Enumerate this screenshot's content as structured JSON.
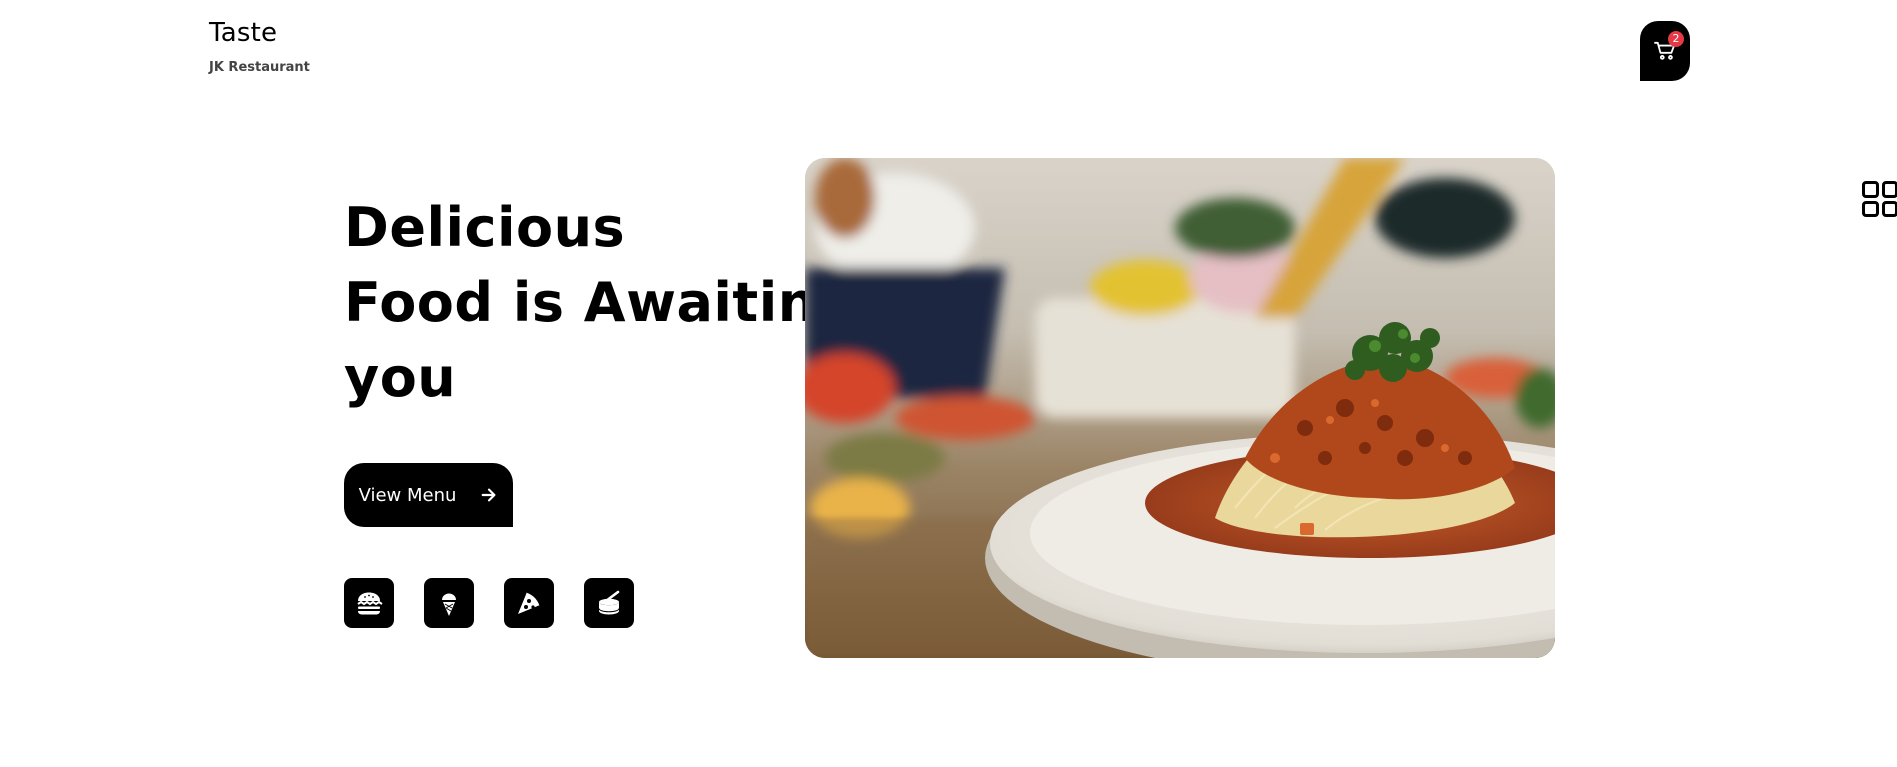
{
  "brand": {
    "title": "Taste",
    "subtitle": "JK Restaurant"
  },
  "cart": {
    "icon": "cart-icon",
    "count": "2",
    "badge_color": "#e63946"
  },
  "side_menu": {
    "icon": "grid-icon"
  },
  "hero": {
    "heading_lines": [
      "Delicious",
      "Food is Awaiting",
      "you"
    ],
    "cta_label": "View Menu",
    "cta_icon": "arrow-right-icon",
    "image": "spaghetti-bolognese-photo"
  },
  "categories": [
    {
      "icon": "burger-icon"
    },
    {
      "icon": "ice-cream-icon"
    },
    {
      "icon": "pizza-icon"
    },
    {
      "icon": "canned-food-icon"
    }
  ],
  "colors": {
    "primary": "#000000",
    "background": "#ffffff",
    "accent": "#e63946"
  }
}
